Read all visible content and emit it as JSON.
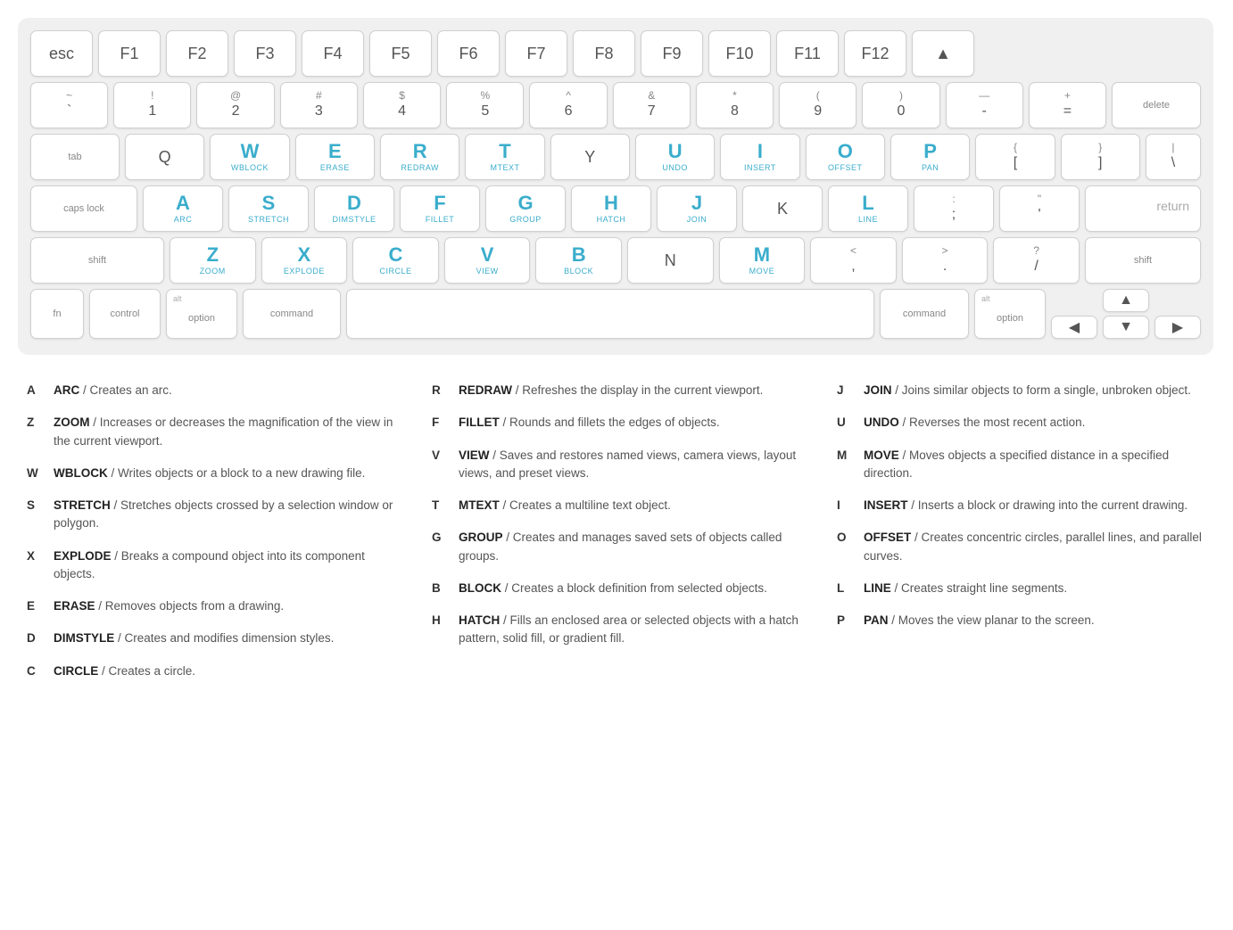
{
  "keyboard": {
    "rows": [
      {
        "id": "row0",
        "keys": [
          {
            "id": "esc",
            "label": "esc",
            "accent": false,
            "sub": "",
            "type": "esc"
          },
          {
            "id": "f1",
            "label": "F1",
            "accent": false,
            "sub": "",
            "type": "fn-row"
          },
          {
            "id": "f2",
            "label": "F2",
            "accent": false,
            "sub": "",
            "type": "fn-row"
          },
          {
            "id": "f3",
            "label": "F3",
            "accent": false,
            "sub": "",
            "type": "fn-row"
          },
          {
            "id": "f4",
            "label": "F4",
            "accent": false,
            "sub": "",
            "type": "fn-row"
          },
          {
            "id": "f5",
            "label": "F5",
            "accent": false,
            "sub": "",
            "type": "fn-row"
          },
          {
            "id": "f6",
            "label": "F6",
            "accent": false,
            "sub": "",
            "type": "fn-row"
          },
          {
            "id": "f7",
            "label": "F7",
            "accent": false,
            "sub": "",
            "type": "fn-row"
          },
          {
            "id": "f8",
            "label": "F8",
            "accent": false,
            "sub": "",
            "type": "fn-row"
          },
          {
            "id": "f9",
            "label": "F9",
            "accent": false,
            "sub": "",
            "type": "fn-row"
          },
          {
            "id": "f10",
            "label": "F10",
            "accent": false,
            "sub": "",
            "type": "fn-row"
          },
          {
            "id": "f11",
            "label": "F11",
            "accent": false,
            "sub": "",
            "type": "fn-row"
          },
          {
            "id": "f12",
            "label": "F12",
            "accent": false,
            "sub": "",
            "type": "fn-row"
          },
          {
            "id": "eject",
            "label": "▲",
            "accent": false,
            "sub": "",
            "type": "fn-row"
          }
        ]
      },
      {
        "id": "row1",
        "keys": [
          {
            "id": "tilde",
            "top": "~",
            "bot": "`",
            "type": "numsym"
          },
          {
            "id": "1",
            "top": "!",
            "bot": "1",
            "type": "numsym"
          },
          {
            "id": "2",
            "top": "@",
            "bot": "2",
            "type": "numsym"
          },
          {
            "id": "3",
            "top": "#",
            "bot": "3",
            "type": "numsym"
          },
          {
            "id": "4",
            "top": "$",
            "bot": "4",
            "type": "numsym"
          },
          {
            "id": "5",
            "top": "%",
            "bot": "5",
            "type": "numsym"
          },
          {
            "id": "6",
            "top": "^",
            "bot": "6",
            "type": "numsym"
          },
          {
            "id": "7",
            "top": "&",
            "bot": "7",
            "type": "numsym"
          },
          {
            "id": "8",
            "top": "*",
            "bot": "8",
            "type": "numsym"
          },
          {
            "id": "9",
            "top": "(",
            "bot": "9",
            "type": "numsym"
          },
          {
            "id": "0",
            "top": ")",
            "bot": "0",
            "type": "numsym"
          },
          {
            "id": "minus",
            "top": "—",
            "bot": "-",
            "type": "numsym"
          },
          {
            "id": "equals",
            "top": "+",
            "bot": "=",
            "type": "numsym"
          },
          {
            "id": "delete",
            "label": "delete",
            "type": "delete"
          }
        ]
      },
      {
        "id": "row2",
        "keys": [
          {
            "id": "tab",
            "label": "tab",
            "type": "tab"
          },
          {
            "id": "q",
            "label": "Q",
            "accent": false,
            "sub": "",
            "type": "normal"
          },
          {
            "id": "w",
            "label": "W",
            "accent": true,
            "sub": "WBLOCK",
            "type": "normal"
          },
          {
            "id": "e",
            "label": "E",
            "accent": true,
            "sub": "ERASE",
            "type": "normal"
          },
          {
            "id": "r",
            "label": "R",
            "accent": true,
            "sub": "REDRAW",
            "type": "normal"
          },
          {
            "id": "t",
            "label": "T",
            "accent": true,
            "sub": "MTEXT",
            "type": "normal"
          },
          {
            "id": "y",
            "label": "Y",
            "accent": false,
            "sub": "",
            "type": "normal"
          },
          {
            "id": "u",
            "label": "U",
            "accent": true,
            "sub": "UNDO",
            "type": "normal"
          },
          {
            "id": "i",
            "label": "I",
            "accent": true,
            "sub": "INSERT",
            "type": "normal"
          },
          {
            "id": "o",
            "label": "O",
            "accent": true,
            "sub": "OFFSET",
            "type": "normal"
          },
          {
            "id": "p",
            "label": "P",
            "accent": true,
            "sub": "PAN",
            "type": "normal"
          },
          {
            "id": "lbracket",
            "top": "{",
            "bot": "[",
            "type": "numsym"
          },
          {
            "id": "rbracket",
            "top": "}",
            "bot": "]",
            "type": "numsym"
          },
          {
            "id": "backslash",
            "top": "|",
            "bot": "\\",
            "type": "backslash"
          }
        ]
      },
      {
        "id": "row3",
        "keys": [
          {
            "id": "caps",
            "label": "caps lock",
            "type": "caps"
          },
          {
            "id": "a",
            "label": "A",
            "accent": true,
            "sub": "ARC",
            "type": "normal"
          },
          {
            "id": "s",
            "label": "S",
            "accent": true,
            "sub": "STRETCH",
            "type": "normal"
          },
          {
            "id": "d",
            "label": "D",
            "accent": true,
            "sub": "DIMSTYLE",
            "type": "normal"
          },
          {
            "id": "f",
            "label": "F",
            "accent": true,
            "sub": "FILLET",
            "type": "normal"
          },
          {
            "id": "g",
            "label": "G",
            "accent": true,
            "sub": "GROUP",
            "type": "normal"
          },
          {
            "id": "h",
            "label": "H",
            "accent": true,
            "sub": "HATCH",
            "type": "normal"
          },
          {
            "id": "j",
            "label": "J",
            "accent": true,
            "sub": "JOIN",
            "type": "normal"
          },
          {
            "id": "k",
            "label": "K",
            "accent": false,
            "sub": "",
            "type": "normal"
          },
          {
            "id": "l",
            "label": "L",
            "accent": true,
            "sub": "LINE",
            "type": "normal"
          },
          {
            "id": "semicolon",
            "top": ":",
            "bot": ";",
            "type": "numsym"
          },
          {
            "id": "quote",
            "top": "\"",
            "bot": "'",
            "type": "numsym"
          },
          {
            "id": "return",
            "label": "return",
            "type": "return"
          }
        ]
      },
      {
        "id": "row4",
        "keys": [
          {
            "id": "shift-l",
            "label": "shift",
            "type": "shift-l"
          },
          {
            "id": "z",
            "label": "Z",
            "accent": true,
            "sub": "ZOOM",
            "type": "normal"
          },
          {
            "id": "x",
            "label": "X",
            "accent": true,
            "sub": "EXPLODE",
            "type": "normal"
          },
          {
            "id": "c",
            "label": "C",
            "accent": true,
            "sub": "CIRCLE",
            "type": "normal"
          },
          {
            "id": "v",
            "label": "V",
            "accent": true,
            "sub": "VIEW",
            "type": "normal"
          },
          {
            "id": "b",
            "label": "B",
            "accent": true,
            "sub": "BLOCK",
            "type": "normal"
          },
          {
            "id": "n",
            "label": "N",
            "accent": false,
            "sub": "",
            "type": "normal"
          },
          {
            "id": "m",
            "label": "M",
            "accent": true,
            "sub": "MOVE",
            "type": "normal"
          },
          {
            "id": "comma",
            "top": "<",
            "bot": ",",
            "type": "numsym"
          },
          {
            "id": "period",
            "top": ">",
            "bot": ".",
            "type": "numsym"
          },
          {
            "id": "slash",
            "top": "?",
            "bot": "/",
            "type": "numsym"
          },
          {
            "id": "shift-r",
            "label": "shift",
            "type": "shift-r"
          }
        ]
      },
      {
        "id": "row5",
        "keys": [
          {
            "id": "fn",
            "label": "fn",
            "type": "fn"
          },
          {
            "id": "control",
            "label": "control",
            "type": "control"
          },
          {
            "id": "alt-l",
            "altlabel": "alt",
            "label": "option",
            "type": "alt"
          },
          {
            "id": "command-l",
            "label": "command",
            "type": "command"
          },
          {
            "id": "space",
            "label": "",
            "type": "space"
          },
          {
            "id": "command-r",
            "label": "command",
            "type": "command-r"
          },
          {
            "id": "alt-r",
            "altlabel": "alt",
            "label": "option",
            "type": "alt-r"
          }
        ]
      }
    ]
  },
  "legend": {
    "columns": [
      [
        {
          "key": "A",
          "command": "ARC",
          "description": "Creates an arc."
        },
        {
          "key": "Z",
          "command": "ZOOM",
          "description": "Increases or decreases the magnification of the view in the current viewport."
        },
        {
          "key": "W",
          "command": "WBLOCK",
          "description": "Writes objects or a block to a new drawing file."
        },
        {
          "key": "S",
          "command": "STRETCH",
          "description": "Stretches objects crossed by a selection window or polygon."
        },
        {
          "key": "X",
          "command": "EXPLODE",
          "description": "Breaks a compound object into its component objects."
        },
        {
          "key": "E",
          "command": "ERASE",
          "description": "Removes objects from a drawing."
        },
        {
          "key": "D",
          "command": "DIMSTYLE",
          "description": "Creates and modifies dimension styles."
        },
        {
          "key": "C",
          "command": "CIRCLE",
          "description": "Creates a circle."
        }
      ],
      [
        {
          "key": "R",
          "command": "REDRAW",
          "description": "Refreshes the display in the current viewport."
        },
        {
          "key": "F",
          "command": "FILLET",
          "description": "Rounds and fillets the edges of objects."
        },
        {
          "key": "V",
          "command": "VIEW",
          "description": "Saves and restores named views, camera views, layout views, and preset views."
        },
        {
          "key": "T",
          "command": "MTEXT",
          "description": "Creates a multiline text object."
        },
        {
          "key": "G",
          "command": "GROUP",
          "description": "Creates and manages saved sets of objects called groups."
        },
        {
          "key": "B",
          "command": "BLOCK",
          "description": "Creates a block definition from selected objects."
        },
        {
          "key": "H",
          "command": "HATCH",
          "description": "Fills an enclosed area or selected objects with a hatch pattern, solid fill, or gradient fill."
        }
      ],
      [
        {
          "key": "J",
          "command": "JOIN",
          "description": "Joins similar objects to form a single, unbroken object."
        },
        {
          "key": "U",
          "command": "UNDO",
          "description": "Reverses the most recent action."
        },
        {
          "key": "M",
          "command": "MOVE",
          "description": "Moves objects a specified distance in a specified direction."
        },
        {
          "key": "I",
          "command": "INSERT",
          "description": "Inserts a block or drawing into the current drawing."
        },
        {
          "key": "O",
          "command": "OFFSET",
          "description": "Creates concentric circles, parallel lines, and parallel curves."
        },
        {
          "key": "L",
          "command": "LINE",
          "description": "Creates straight line segments."
        },
        {
          "key": "P",
          "command": "PAN",
          "description": "Moves the view planar to the screen."
        }
      ]
    ]
  }
}
